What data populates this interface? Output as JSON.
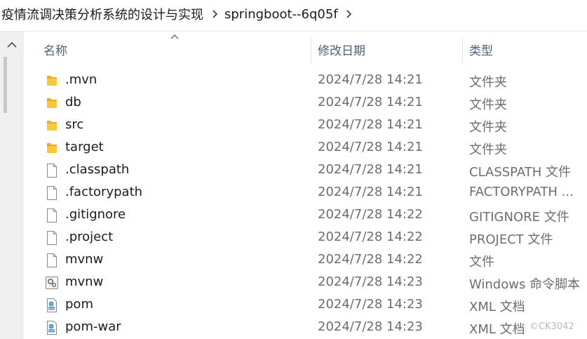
{
  "breadcrumb": {
    "items": [
      "疫情流调决策分析系统的设计与实现",
      "springboot--6q05f"
    ],
    "separator_icon": "chevron-right-icon"
  },
  "columns": {
    "name": "名称",
    "date_modified": "修改日期",
    "type": "类型",
    "sort_indicator": "ascending"
  },
  "files": [
    {
      "name": ".mvn",
      "date": "2024/7/28 14:21",
      "type": "文件夹",
      "icon": "folder-icon"
    },
    {
      "name": "db",
      "date": "2024/7/28 14:21",
      "type": "文件夹",
      "icon": "folder-icon"
    },
    {
      "name": "src",
      "date": "2024/7/28 14:21",
      "type": "文件夹",
      "icon": "folder-icon"
    },
    {
      "name": "target",
      "date": "2024/7/28 14:21",
      "type": "文件夹",
      "icon": "folder-icon"
    },
    {
      "name": ".classpath",
      "date": "2024/7/28 14:21",
      "type": "CLASSPATH 文件",
      "icon": "file-icon"
    },
    {
      "name": ".factorypath",
      "date": "2024/7/28 14:21",
      "type": "FACTORYPATH ...",
      "icon": "file-icon"
    },
    {
      "name": ".gitignore",
      "date": "2024/7/28 14:22",
      "type": "GITIGNORE 文件",
      "icon": "file-icon"
    },
    {
      "name": ".project",
      "date": "2024/7/28 14:22",
      "type": "PROJECT 文件",
      "icon": "file-icon"
    },
    {
      "name": "mvnw",
      "date": "2024/7/28 14:22",
      "type": "文件",
      "icon": "file-icon"
    },
    {
      "name": "mvnw",
      "date": "2024/7/28 14:23",
      "type": "Windows 命令脚本",
      "icon": "gear-script-icon"
    },
    {
      "name": "pom",
      "date": "2024/7/28 14:23",
      "type": "XML 文档",
      "icon": "xml-file-icon"
    },
    {
      "name": "pom-war",
      "date": "2024/7/28 14:23",
      "type": "XML 文档",
      "icon": "xml-file-icon"
    }
  ],
  "watermark": "©CK3042",
  "colors": {
    "folder": "#f8c83c",
    "header_text": "#4c607a",
    "secondary_text": "#6d6d6d"
  }
}
